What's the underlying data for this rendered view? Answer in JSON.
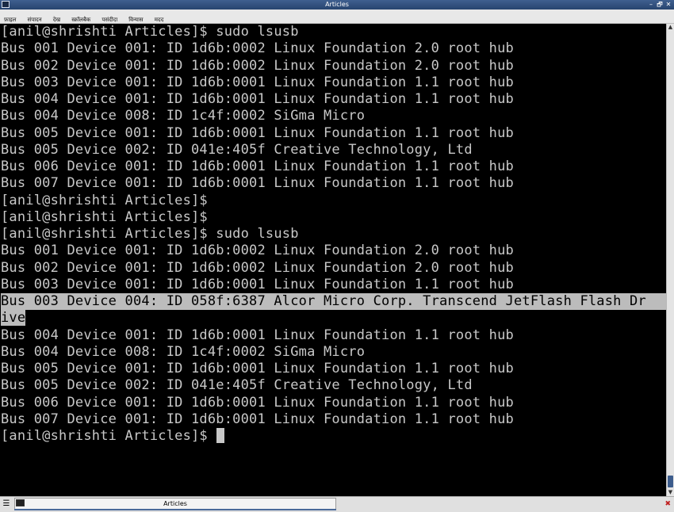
{
  "window": {
    "title": "Articles",
    "controls": {
      "minimize": "–",
      "maximize": "🗗",
      "close": "✕"
    }
  },
  "menu": [
    "फ़ाइल",
    "संपादन",
    "देख",
    "स्क्रॉलबैक",
    "पसंदीदा",
    "विन्यास",
    "मदद"
  ],
  "terminal": {
    "lines": [
      "[anil@shrishti Articles]$ sudo lsusb",
      "Bus 001 Device 001: ID 1d6b:0002 Linux Foundation 2.0 root hub",
      "Bus 002 Device 001: ID 1d6b:0002 Linux Foundation 2.0 root hub",
      "Bus 003 Device 001: ID 1d6b:0001 Linux Foundation 1.1 root hub",
      "Bus 004 Device 001: ID 1d6b:0001 Linux Foundation 1.1 root hub",
      "Bus 004 Device 008: ID 1c4f:0002 SiGma Micro",
      "Bus 005 Device 001: ID 1d6b:0001 Linux Foundation 1.1 root hub",
      "Bus 005 Device 002: ID 041e:405f Creative Technology, Ltd",
      "Bus 006 Device 001: ID 1d6b:0001 Linux Foundation 1.1 root hub",
      "Bus 007 Device 001: ID 1d6b:0001 Linux Foundation 1.1 root hub",
      "[anil@shrishti Articles]$",
      "[anil@shrishti Articles]$",
      "[anil@shrishti Articles]$ sudo lsusb",
      "Bus 001 Device 001: ID 1d6b:0002 Linux Foundation 2.0 root hub",
      "Bus 002 Device 001: ID 1d6b:0002 Linux Foundation 2.0 root hub",
      "Bus 003 Device 001: ID 1d6b:0001 Linux Foundation 1.1 root hub",
      "Bus 003 Device 004: ID 058f:6387 Alcor Micro Corp. Transcend JetFlash Flash Dr",
      "ive",
      "Bus 004 Device 001: ID 1d6b:0001 Linux Foundation 1.1 root hub",
      "Bus 004 Device 008: ID 1c4f:0002 SiGma Micro",
      "Bus 005 Device 001: ID 1d6b:0001 Linux Foundation 1.1 root hub",
      "Bus 005 Device 002: ID 041e:405f Creative Technology, Ltd",
      "Bus 006 Device 001: ID 1d6b:0001 Linux Foundation 1.1 root hub",
      "Bus 007 Device 001: ID 1d6b:0001 Linux Foundation 1.1 root hub"
    ],
    "highlighted_lines": [
      16,
      17
    ],
    "prompt": "[anil@shrishti Articles]$ ",
    "colors": {
      "background": "#000000",
      "text": "#c8c8c8",
      "selection": "#bcbcbc"
    }
  },
  "taskbar": {
    "task_label": "Articles"
  }
}
